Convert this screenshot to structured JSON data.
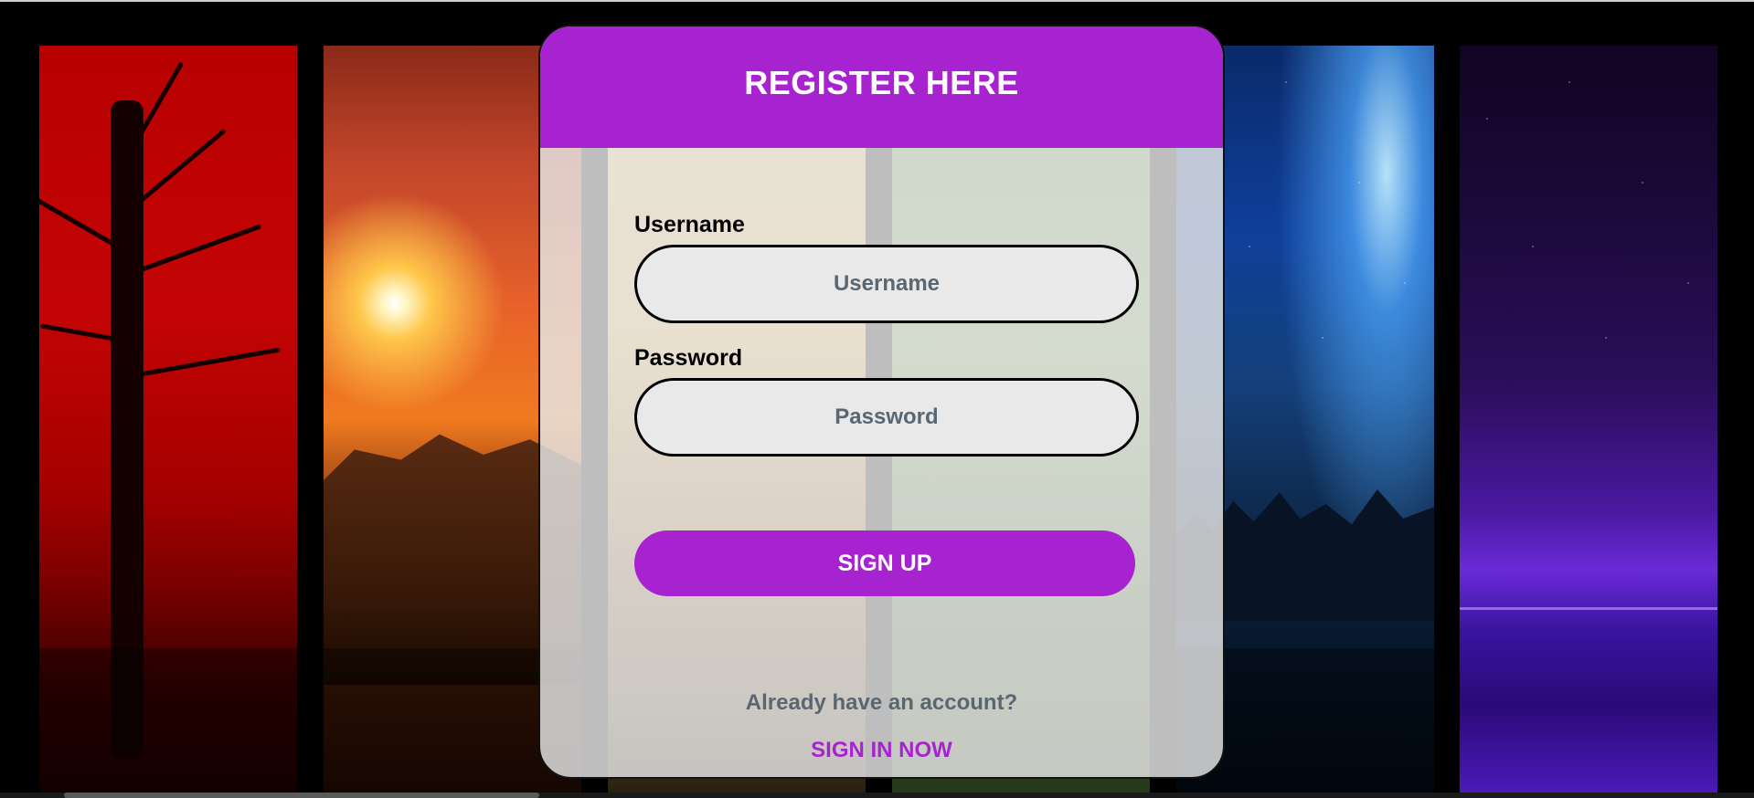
{
  "theme": {
    "accent": "#a723cf",
    "card_background": "#e8e8e8",
    "muted_text": "#5b6770"
  },
  "background": {
    "panels": [
      {
        "name": "red-tree-panel",
        "color": "#b80000"
      },
      {
        "name": "orange-sunset-panel",
        "color": "#e8622a"
      },
      {
        "name": "warm-haze-panel",
        "color": "#e6d392"
      },
      {
        "name": "green-forest-panel",
        "color": "#5e8a4a"
      },
      {
        "name": "blue-comet-panel",
        "color": "#0f3f9a"
      },
      {
        "name": "purple-night-panel",
        "color": "#4a18a0"
      }
    ]
  },
  "card": {
    "title": "REGISTER HERE",
    "username": {
      "label": "Username",
      "placeholder": "Username",
      "value": ""
    },
    "password": {
      "label": "Password",
      "placeholder": "Password",
      "value": ""
    },
    "signup_label": "SIGN UP",
    "already_text": "Already have an account?",
    "signin_label": "SIGN IN NOW"
  }
}
